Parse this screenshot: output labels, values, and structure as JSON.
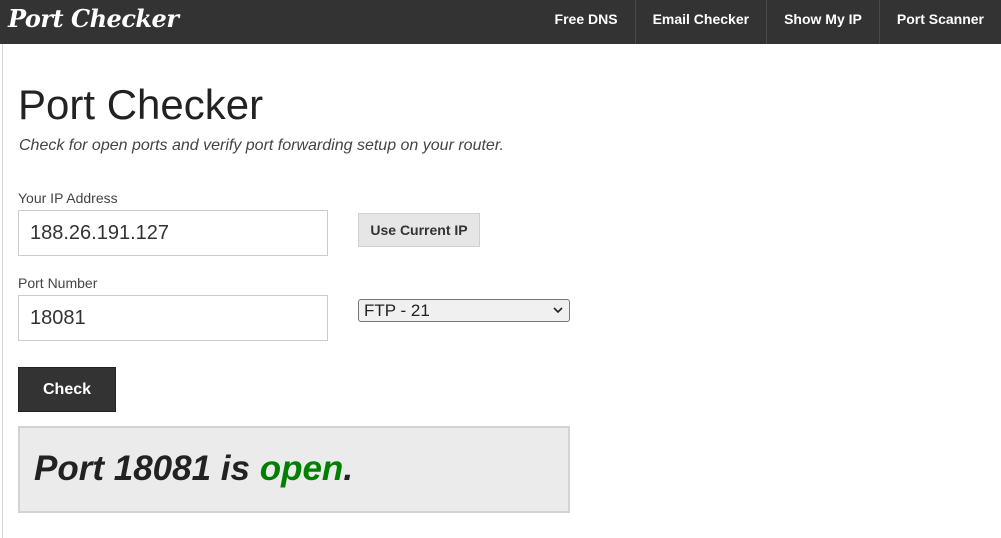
{
  "header": {
    "brand": "Port Checker",
    "nav": [
      {
        "label": "Free DNS"
      },
      {
        "label": "Email Checker"
      },
      {
        "label": "Show My IP"
      },
      {
        "label": "Port Scanner"
      }
    ]
  },
  "main": {
    "title": "Port Checker",
    "subtitle": "Check for open ports and verify port forwarding setup on your router.",
    "ip_label": "Your IP Address",
    "ip_value": "188.26.191.127",
    "use_current_ip": "Use Current IP",
    "port_label": "Port Number",
    "port_value": "18081",
    "service_select": "FTP - 21",
    "check_button": "Check",
    "result": {
      "prefix": "Port 18081 is ",
      "status": "open",
      "suffix": "."
    }
  },
  "colors": {
    "nav_bg": "#333333",
    "status_open": "#008000",
    "result_bg": "#ebebeb"
  }
}
